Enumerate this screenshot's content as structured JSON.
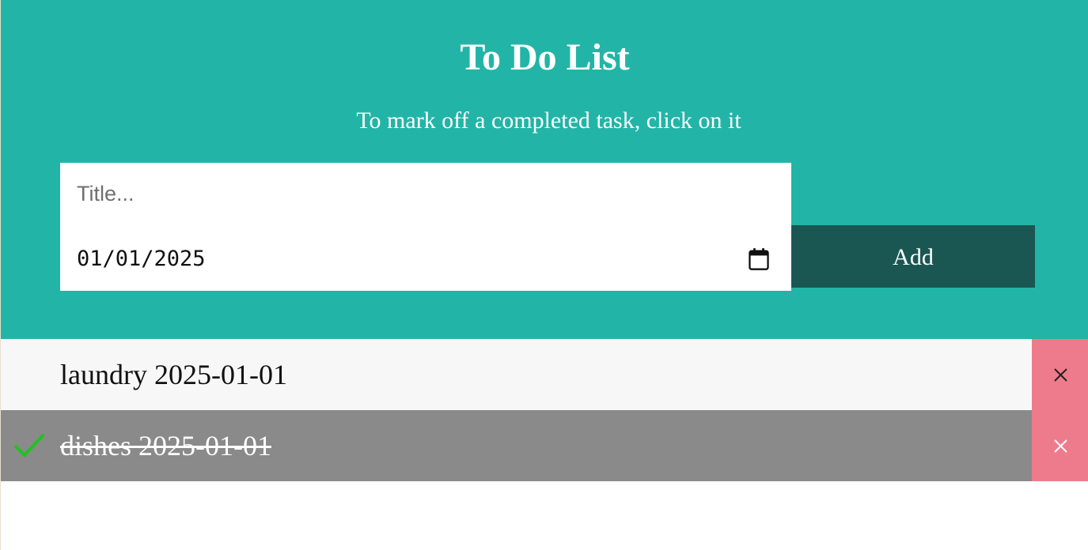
{
  "header": {
    "title": "To Do List",
    "subtitle": "To mark off a completed task, click on it"
  },
  "form": {
    "title_placeholder": "Title...",
    "title_value": "",
    "date_value": "01/01/2025",
    "calendar_icon": "calendar-icon",
    "add_label": "Add"
  },
  "tasks": [
    {
      "text": "laundry 2025-01-01",
      "completed": false
    },
    {
      "text": "dishes 2025-01-01",
      "completed": true
    }
  ],
  "colors": {
    "header_bg": "#22b5a7",
    "add_button_bg": "#1a5753",
    "delete_bg": "#ee7b8b",
    "completed_bg": "#8a8a8a",
    "check": "#1fc21f"
  }
}
